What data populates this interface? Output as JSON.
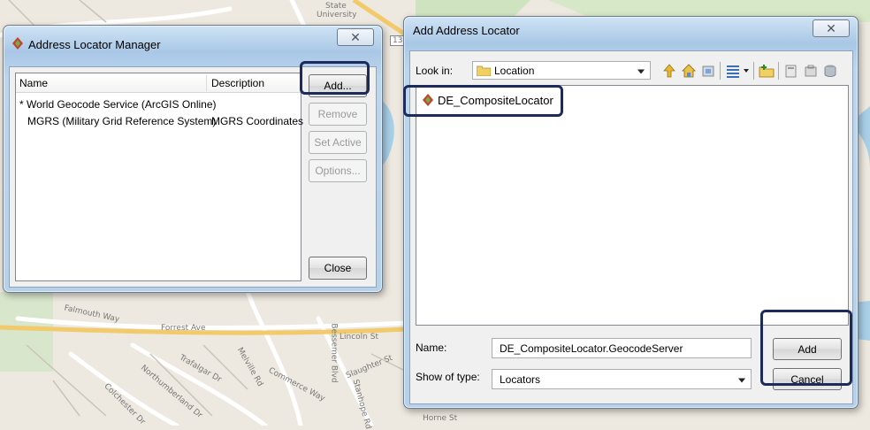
{
  "map": {
    "labels": [
      "State",
      "University",
      "Falmouth Way",
      "Forrest Ave",
      "Lincoln St",
      "Slaughter St",
      "Trafalgar Dr",
      "Melville Rd",
      "Commerce Way",
      "Northumberland Dr",
      "Colchester Dr",
      "Bessemer Blvd",
      "Stanhope Rd",
      "Horne St",
      "13"
    ]
  },
  "manager": {
    "title": "Address Locator Manager",
    "columns": {
      "name": "Name",
      "description": "Description"
    },
    "rows": [
      {
        "name": "* World Geocode Service (ArcGIS Online)",
        "description": ""
      },
      {
        "name": "MGRS (Military Grid Reference System)",
        "description": "MGRS Coordinates"
      }
    ],
    "buttons": {
      "add": "Add...",
      "remove": "Remove",
      "set_active": "Set Active",
      "options": "Options...",
      "close": "Close"
    },
    "close_glyph": "✕"
  },
  "dialog": {
    "title": "Add Address Locator",
    "look_in_label": "Look in:",
    "look_in_value": "Location",
    "items": [
      {
        "label": "DE_CompositeLocator"
      }
    ],
    "name_label": "Name:",
    "name_value": "DE_CompositeLocator.GeocodeServer",
    "type_label": "Show of type:",
    "type_value": "Locators",
    "buttons": {
      "add": "Add",
      "cancel": "Cancel"
    },
    "close_glyph": "✕"
  },
  "colors": {
    "highlight": "#1d2b5c",
    "window_frame": "#b6d1ea",
    "map_water": "#a9d0e8"
  }
}
